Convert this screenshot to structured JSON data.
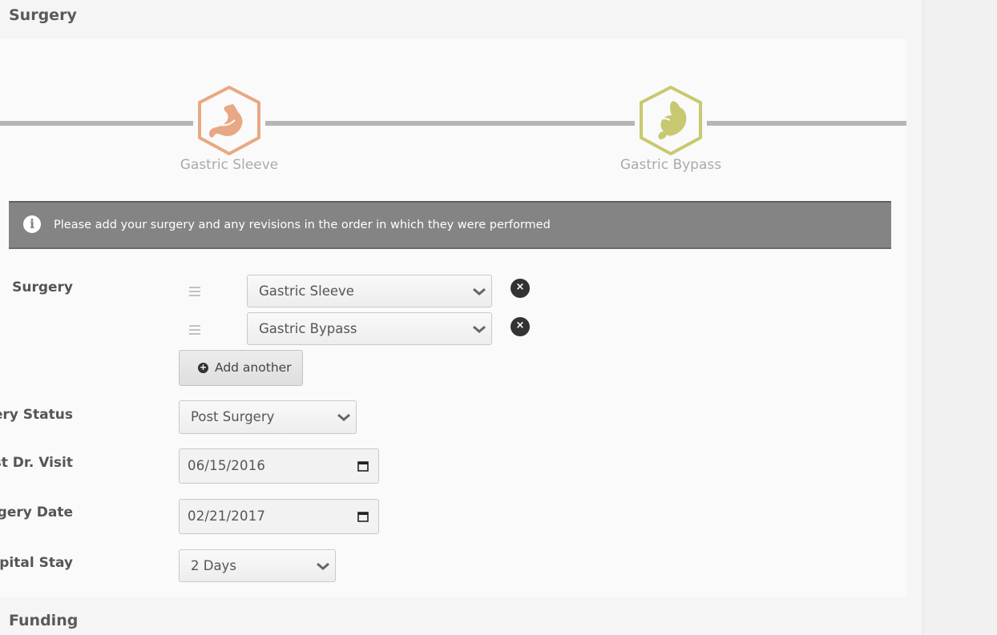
{
  "sections": {
    "surgery_title": "Surgery",
    "funding_title": "Funding"
  },
  "timeline": {
    "items": [
      {
        "label": "Gastric Sleeve",
        "color": "#e8a883",
        "icon": "stomach-icon"
      },
      {
        "label": "Gastric Bypass",
        "color": "#c8c870",
        "icon": "stomach-bypass-icon"
      }
    ]
  },
  "info_banner": {
    "icon": "info-icon",
    "text": "Please add your surgery and any revisions in the order in which they were performed"
  },
  "form": {
    "surgery_label": "Surgery",
    "surgeries": [
      {
        "value": "Gastric Sleeve"
      },
      {
        "value": "Gastric Bypass"
      }
    ],
    "remove_glyph": "×",
    "add_another_label": "Add another",
    "surgery_status_label": "Surgery Status",
    "surgery_status_value": "Post Surgery",
    "first_visit_label": "First Dr. Visit",
    "first_visit_value": "06/15/2016",
    "surgery_date_label": "Surgery Date",
    "surgery_date_value": "02/21/2017",
    "hospital_stay_label": "Hospital Stay",
    "hospital_stay_value": "2 Days"
  }
}
